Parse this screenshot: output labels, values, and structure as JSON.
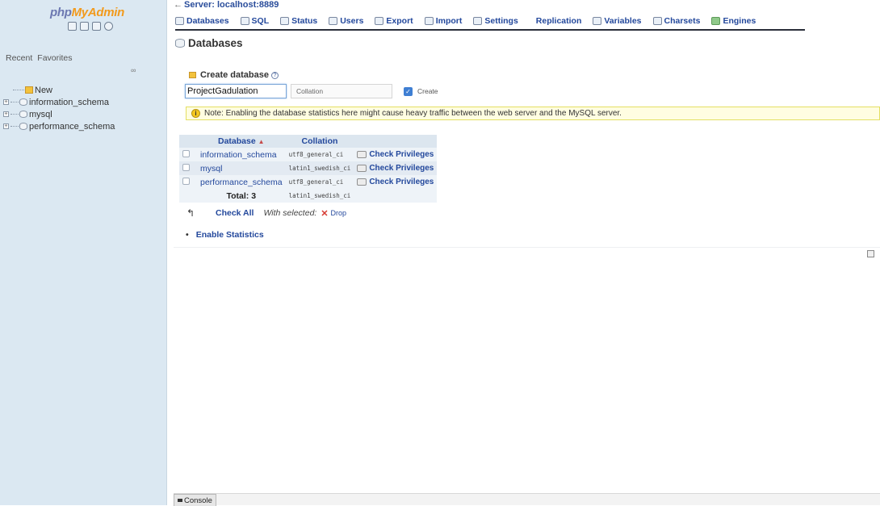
{
  "navigation": {
    "logo": {
      "part1": "php",
      "part2": "My",
      "part3": "Admin"
    },
    "icons": [
      "home-icon",
      "logout-icon",
      "docs-icon",
      "reload-icon"
    ],
    "tabs": [
      "Recent",
      "Favorites"
    ],
    "collapse_label": "∞",
    "tree": [
      {
        "label": "New",
        "icon": "new-db-icon"
      },
      {
        "label": "information_schema",
        "icon": "database-icon"
      },
      {
        "label": "mysql",
        "icon": "database-icon"
      },
      {
        "label": "performance_schema",
        "icon": "database-icon"
      }
    ]
  },
  "breadcrumb": {
    "server": "Server: localhost:8889"
  },
  "topmenu": [
    {
      "label": "Databases",
      "icon": "databases-icon"
    },
    {
      "label": "SQL",
      "icon": "sql-icon"
    },
    {
      "label": "Status",
      "icon": "status-icon"
    },
    {
      "label": "Users",
      "icon": "users-icon"
    },
    {
      "label": "Export",
      "icon": "export-icon"
    },
    {
      "label": "Import",
      "icon": "import-icon"
    },
    {
      "label": "Settings",
      "icon": "settings-icon"
    },
    {
      "label": "Replication",
      "icon": "replication-icon"
    },
    {
      "label": "Variables",
      "icon": "variables-icon"
    },
    {
      "label": "Charsets",
      "icon": "charsets-icon"
    },
    {
      "label": "Engines",
      "icon": "engines-icon"
    }
  ],
  "page": {
    "title": "Databases",
    "create_database_label": "Create database",
    "db_name_value": "ProjectGadulation",
    "collation_placeholder": "Collation",
    "create_button": "Create",
    "notice": "Note: Enabling the database statistics here might cause heavy traffic between the web server and the MySQL server."
  },
  "table": {
    "headers": {
      "database": "Database",
      "collation": "Collation"
    },
    "rows": [
      {
        "database": "information_schema",
        "collation": "utf8_general_ci",
        "action": "Check Privileges"
      },
      {
        "database": "mysql",
        "collation": "latin1_swedish_ci",
        "action": "Check Privileges"
      },
      {
        "database": "performance_schema",
        "collation": "utf8_general_ci",
        "action": "Check Privileges"
      }
    ],
    "total_label": "Total: 3",
    "total_collation": "latin1_swedish_ci"
  },
  "bulk": {
    "check_all": "Check All",
    "with_selected": "With selected:",
    "drop": "Drop"
  },
  "enable_statistics": "Enable Statistics",
  "console": {
    "label": "Console"
  },
  "colors": {
    "link": "#23489c",
    "nav_bg": "#dbe8f2",
    "notice_bg": "#fffde1",
    "notice_border": "#e4df62"
  }
}
